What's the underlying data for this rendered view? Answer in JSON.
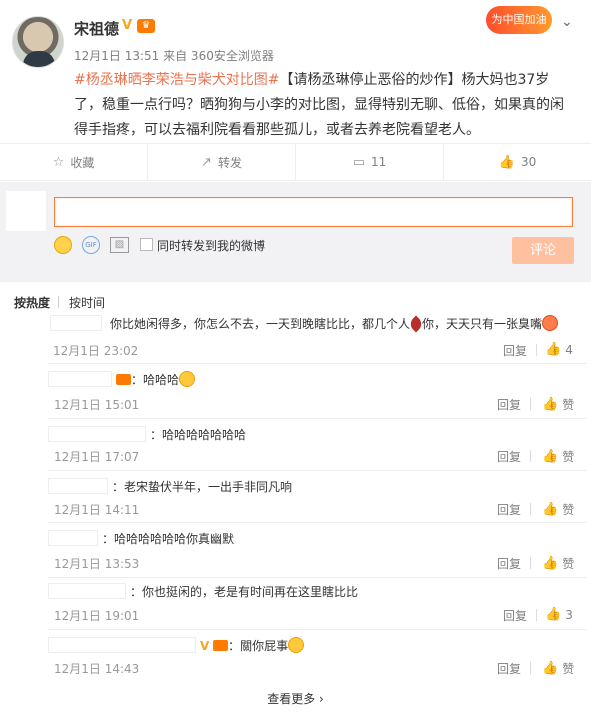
{
  "post": {
    "username": "宋祖德",
    "meta": "12月1日 13:51 来自 360安全浏览器",
    "topic": "#杨丞琳晒李荣浩与柴犬对比图#",
    "text": "【请杨丞琳停止恶俗的炒作】杨大妈也37岁了，稳重一点行吗？晒狗狗与小李的对比图，显得特别无聊、低俗，如果真的闲得手指疼，可以去福利院看看那些孤儿，或者去养老院看望老人。",
    "ad_badge": "为中国加油"
  },
  "actions": {
    "favorite": "收藏",
    "repost": "转发",
    "comment_count": "11",
    "like_count": "30"
  },
  "composer": {
    "placeholder": "",
    "forward_label": "同时转发到我的微博",
    "submit_label": "评论",
    "gif_label": "GIF"
  },
  "sort": {
    "hot": "按热度",
    "time": "按时间"
  },
  "comments": [
    {
      "text": "你比她闲得多，你怎么不去，一天到晚瞎比比，都几个人",
      "text2": "你，天天只有一张臭嘴",
      "time": "12月1日 23:02",
      "reply": "回复",
      "like": "4"
    },
    {
      "text": "：哈哈哈",
      "time": "12月1日 15:01",
      "reply": "回复",
      "like": "赞"
    },
    {
      "text": "：哈哈哈哈哈哈哈",
      "time": "12月1日 17:07",
      "reply": "回复",
      "like": "赞"
    },
    {
      "text": "：老宋蛰伏半年，一出手非同凡响",
      "time": "12月1日 14:11",
      "reply": "回复",
      "like": "赞"
    },
    {
      "text": "：哈哈哈哈哈哈你真幽默",
      "time": "12月1日 13:53",
      "reply": "回复",
      "like": "赞"
    },
    {
      "text": "：你也挺闲的，老是有时间再在这里瞎比比",
      "time": "12月1日 19:01",
      "reply": "回复",
      "like": "3"
    },
    {
      "text": "：關你屁事",
      "time": "12月1日 14:43",
      "reply": "回复",
      "like": "赞"
    }
  ],
  "more": "查看更多 ›",
  "colors": {
    "accent": "#eb7350",
    "input_border": "#fa7d3c",
    "submit_disabled": "#ffc09f"
  }
}
